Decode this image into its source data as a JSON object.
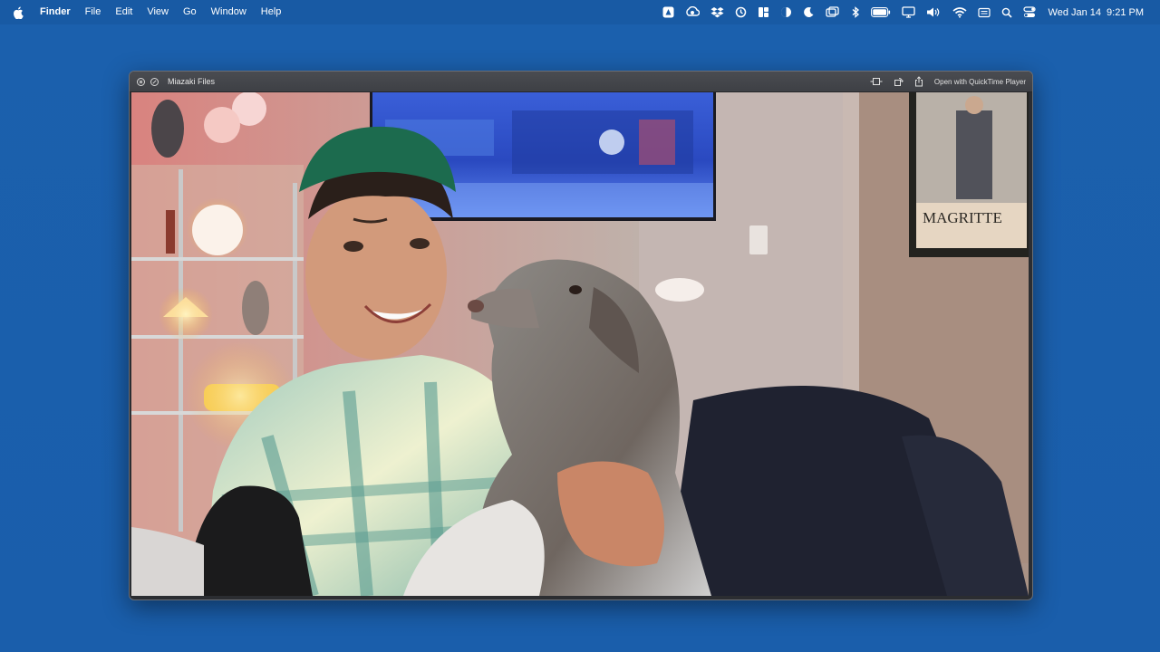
{
  "menubar": {
    "app_name": "Finder",
    "menus": [
      "File",
      "Edit",
      "View",
      "Go",
      "Window",
      "Help"
    ],
    "status_icons": [
      "creative-cloud-icon",
      "backup-icon",
      "dropbox-icon",
      "sync-icon",
      "window-manager-icon",
      "screen-time-icon",
      "focus-moon-icon",
      "screen-mirroring-icon",
      "bluetooth-icon",
      "battery-icon",
      "display-icon",
      "volume-icon",
      "wifi-icon",
      "keyboard-input-icon",
      "spotlight-icon",
      "control-center-icon"
    ],
    "clock": {
      "date": "Wed Jan 14",
      "time": "9:21 PM"
    }
  },
  "window": {
    "title": "Miazaki Files",
    "open_with_label": "Open with QuickTime Player"
  },
  "media": {
    "poster_text": "MAGRITTE"
  },
  "colors": {
    "desktop": "#1a5fae",
    "menubar": "#185aa4",
    "titlebar": "#434549"
  }
}
